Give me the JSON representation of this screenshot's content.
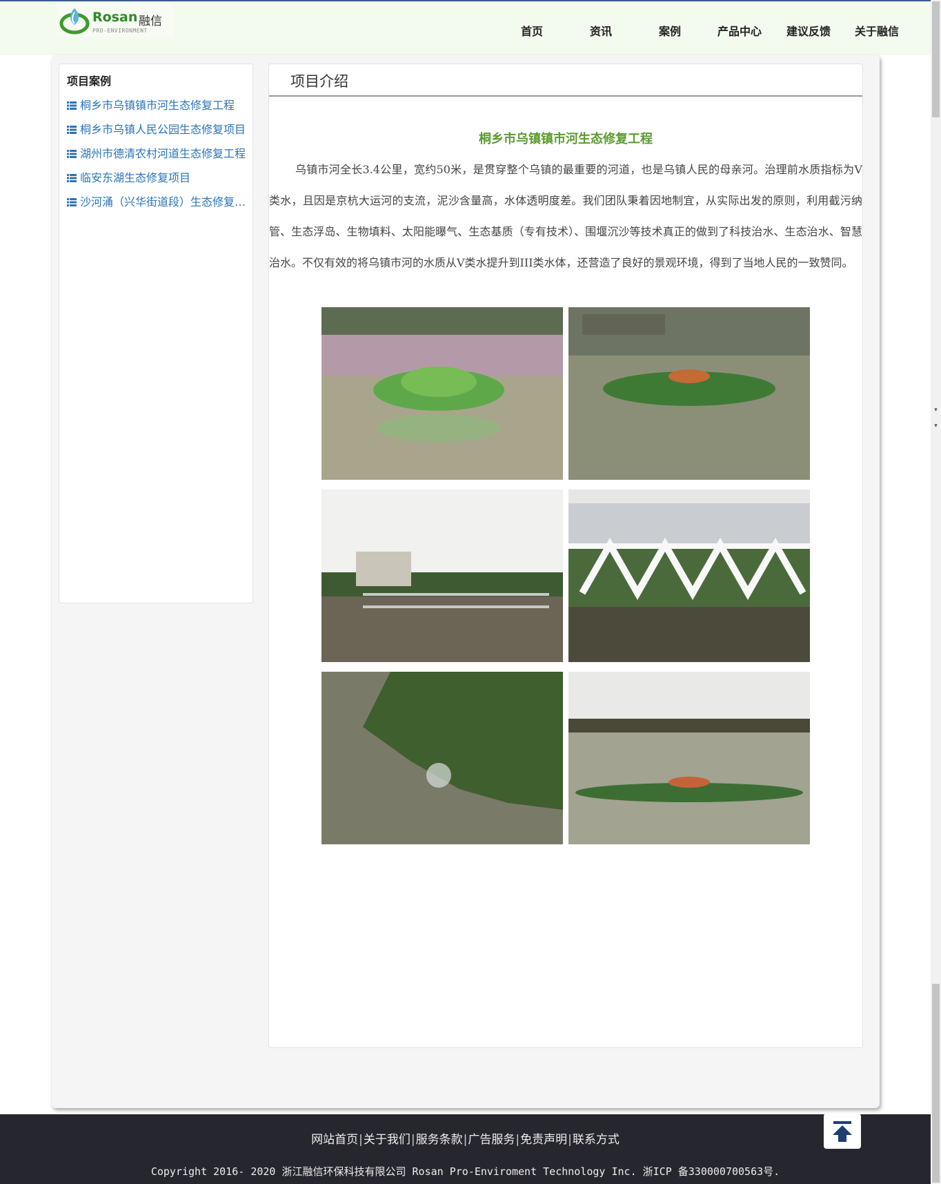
{
  "brand": {
    "name_en": "Rosan",
    "name_cn": "融信",
    "tagline": "PRO-ENVIRONMENT"
  },
  "nav": [
    "首页",
    "资讯",
    "案例",
    "产品中心",
    "建议反馈",
    "关于融信"
  ],
  "sidebar": {
    "title": "项目案例",
    "items": [
      "桐乡市乌镇镇市河生态修复工程",
      "桐乡市乌镇人民公园生态修复项目",
      "湖州市德清农村河道生态修复工程",
      "临安东湖生态修复项目",
      "沙河涌（兴华街道段）生态修复工程"
    ]
  },
  "content": {
    "section_title": "项目介绍",
    "article_title": "桐乡市乌镇镇市河生态修复工程",
    "article_body": "乌镇市河全长3.4公里，宽约50米，是贯穿整个乌镇的最重要的河道，也是乌镇人民的母亲河。治理前水质指标为V类水，且因是京杭大运河的支流，泥沙含量高，水体透明度差。我们团队秉着因地制宜，从实际出发的原则，利用截污纳管、生态浮岛、生物填料、太阳能曝气、生态基质（专有技术）、围堰沉沙等技术真正的做到了科技治水、生态治水、智慧治水。不仅有效的将乌镇市河的水质从V类水提升到III类水体，还营造了良好的景观环境，得到了当地人民的一致赞同。"
  },
  "footer": {
    "links": [
      "网站首页",
      "关于我们",
      "服务条款",
      "广告服务",
      "免责声明",
      "联系方式"
    ],
    "copyright": "Copyright 2016- 2020 浙江融信环保科技有限公司 Rosan Pro-Enviroment Technology Inc. 浙ICP 备330000700563号."
  },
  "colors": {
    "header_bg": "#f3faee",
    "accent_green": "#5b9b2e",
    "link_blue": "#2a73b8",
    "footer_bg": "#26262e"
  }
}
